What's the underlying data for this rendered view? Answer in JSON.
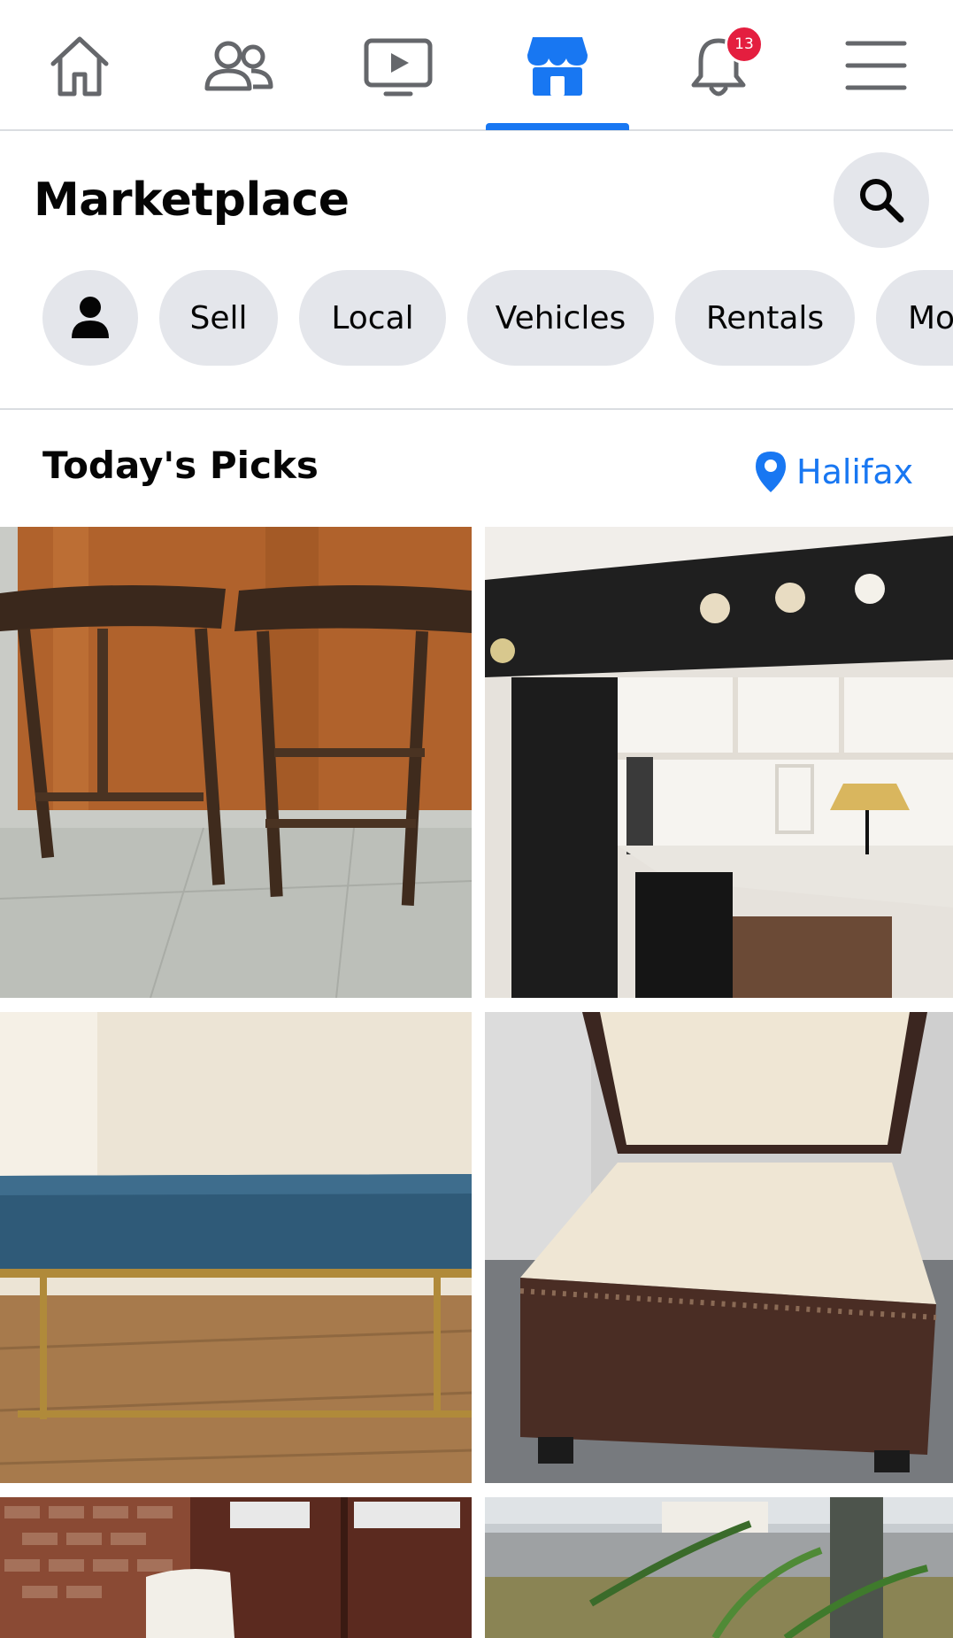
{
  "nav": {
    "items": [
      {
        "icon": "home-icon"
      },
      {
        "icon": "friends-icon"
      },
      {
        "icon": "watch-icon"
      },
      {
        "icon": "marketplace-icon",
        "active": true
      },
      {
        "icon": "notifications-icon"
      },
      {
        "icon": "menu-icon"
      }
    ],
    "notification_count": "13",
    "active_color": "#1877f2",
    "badge_color": "#e41e3f"
  },
  "header": {
    "title": "Marketplace",
    "search_icon": "search-icon"
  },
  "chips": [
    {
      "icon": "profile-icon"
    },
    {
      "label": "Sell"
    },
    {
      "label": "Local"
    },
    {
      "label": "Vehicles"
    },
    {
      "label": "Rentals"
    },
    {
      "label": "Mo"
    }
  ],
  "picks": {
    "title": "Today's Picks",
    "location": "Halifax",
    "location_icon": "location-pin-icon"
  },
  "listings": [
    {
      "image": "bar-stools"
    },
    {
      "image": "loft-bed-desk"
    },
    {
      "image": "velvet-bench"
    },
    {
      "image": "storage-ottoman"
    },
    {
      "image": "brick-wall-door-chair"
    },
    {
      "image": "plant-window-yard"
    }
  ]
}
